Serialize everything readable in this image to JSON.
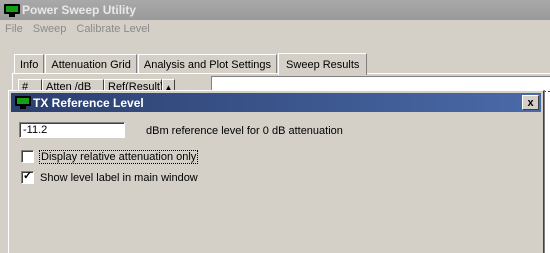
{
  "app": {
    "title": "Power Sweep Utility"
  },
  "menu": [
    "File",
    "Sweep",
    "Calibrate Level"
  ],
  "tabs": [
    {
      "label": "Info",
      "active": false
    },
    {
      "label": "Attenuation Grid",
      "active": false
    },
    {
      "label": "Analysis and Plot Settings",
      "active": false
    },
    {
      "label": "Sweep Results",
      "active": true
    }
  ],
  "grid": {
    "columns": [
      "#",
      "Atten /dB",
      "Ref(Result)"
    ]
  },
  "dialog": {
    "title": "TX Reference Level",
    "close_glyph": "x",
    "reference_value": "-11.2",
    "reference_label": "dBm reference level for 0 dB attenuation",
    "options": [
      {
        "label": "Display relative attenuation only",
        "checked": false
      },
      {
        "label": "Show level label in main window",
        "checked": true
      }
    ]
  },
  "colors": {
    "titlebar_active": "#2b3f6e",
    "accent_dash": "#1f3fbf"
  }
}
